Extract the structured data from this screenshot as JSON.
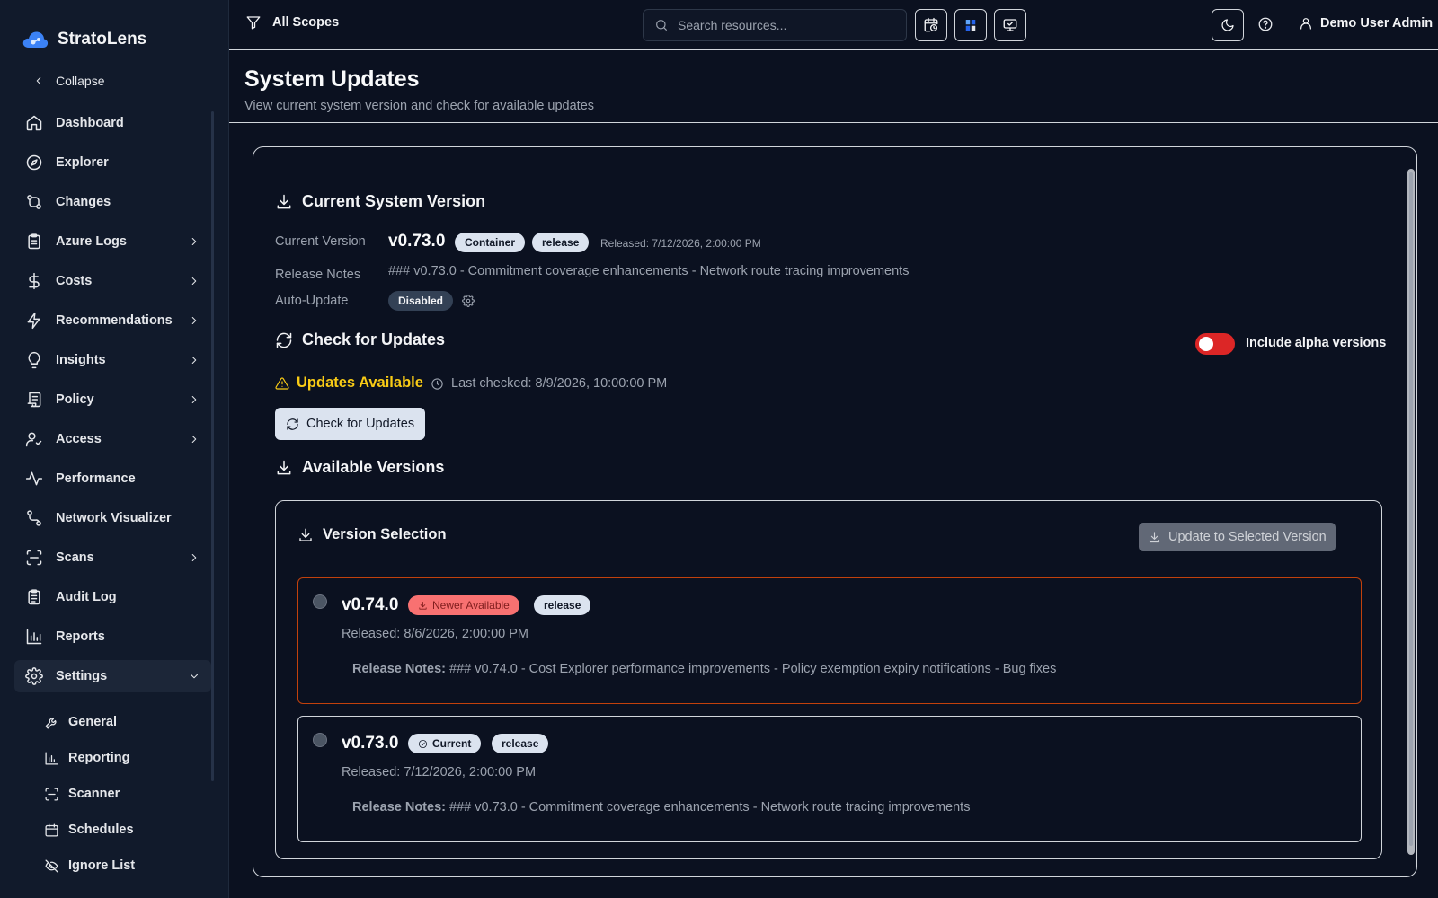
{
  "app": {
    "brand": "StratoLens",
    "collapse_label": "Collapse"
  },
  "sidebar": {
    "items": [
      {
        "label": "Dashboard",
        "icon": "home-icon"
      },
      {
        "label": "Explorer",
        "icon": "compass-icon"
      },
      {
        "label": "Changes",
        "icon": "git-compare-icon"
      },
      {
        "label": "Azure Logs",
        "icon": "clipboard-icon"
      },
      {
        "label": "Costs",
        "icon": "dollar-icon"
      },
      {
        "label": "Recommendations",
        "icon": "zap-icon"
      },
      {
        "label": "Insights",
        "icon": "lightbulb-icon"
      },
      {
        "label": "Policy",
        "icon": "scroll-icon"
      },
      {
        "label": "Access",
        "icon": "user-check-icon"
      },
      {
        "label": "Performance",
        "icon": "activity-icon"
      },
      {
        "label": "Network Visualizer",
        "icon": "route-icon"
      },
      {
        "label": "Scans",
        "icon": "scan-icon"
      },
      {
        "label": "Audit Log",
        "icon": "clipboard-list-icon"
      },
      {
        "label": "Reports",
        "icon": "bar-chart-icon"
      },
      {
        "label": "Settings",
        "icon": "gear-icon"
      }
    ],
    "settings_sub": [
      {
        "label": "General",
        "icon": "wrench-icon"
      },
      {
        "label": "Reporting",
        "icon": "chart-icon"
      },
      {
        "label": "Scanner",
        "icon": "scan-icon"
      },
      {
        "label": "Schedules",
        "icon": "calendar-icon"
      },
      {
        "label": "Ignore List",
        "icon": "eye-off-icon"
      }
    ]
  },
  "topbar": {
    "scope_label": "All Scopes",
    "search_placeholder": "Search resources...",
    "user_name": "Demo User Admin"
  },
  "page": {
    "title": "System Updates",
    "subtitle": "View current system version and check for available updates"
  },
  "current": {
    "heading": "Current System Version",
    "version_label": "Current Version",
    "version": "v0.73.0",
    "type_badge": "Container",
    "channel_badge": "release",
    "released": "Released: 7/12/2026, 2:00:00 PM",
    "notes_label": "Release Notes",
    "notes": "### v0.73.0 - Commitment coverage enhancements - Network route tracing improvements",
    "auto_update_label": "Auto-Update",
    "auto_update_value": "Disabled"
  },
  "check": {
    "heading": "Check for Updates",
    "alpha_label": "Include alpha versions",
    "alpha_enabled": false,
    "status": "Updates Available",
    "last_checked": "Last checked: 8/9/2026, 10:00:00 PM",
    "button": "Check for Updates"
  },
  "available": {
    "heading": "Available Versions",
    "selection_heading": "Version Selection",
    "update_button": "Update to Selected Version",
    "notes_prefix": "Release Notes:",
    "versions": [
      {
        "version": "v0.74.0",
        "status_badge": "Newer Available",
        "channel": "release",
        "released": "Released: 8/6/2026, 2:00:00 PM",
        "notes": "### v0.74.0 - Cost Explorer performance improvements - Policy exemption expiry notifications - Bug fixes"
      },
      {
        "version": "v0.73.0",
        "status_badge": "Current",
        "channel": "release",
        "released": "Released: 7/12/2026, 2:00:00 PM",
        "notes": "### v0.73.0 - Commitment coverage enhancements - Network route tracing improvements"
      }
    ]
  },
  "colors": {
    "accent_blue": "#3b82f6",
    "warning": "#facc15",
    "toggle_off": "#dc2626",
    "newer_border": "#c2410c",
    "newer_badge": "#f87171"
  }
}
